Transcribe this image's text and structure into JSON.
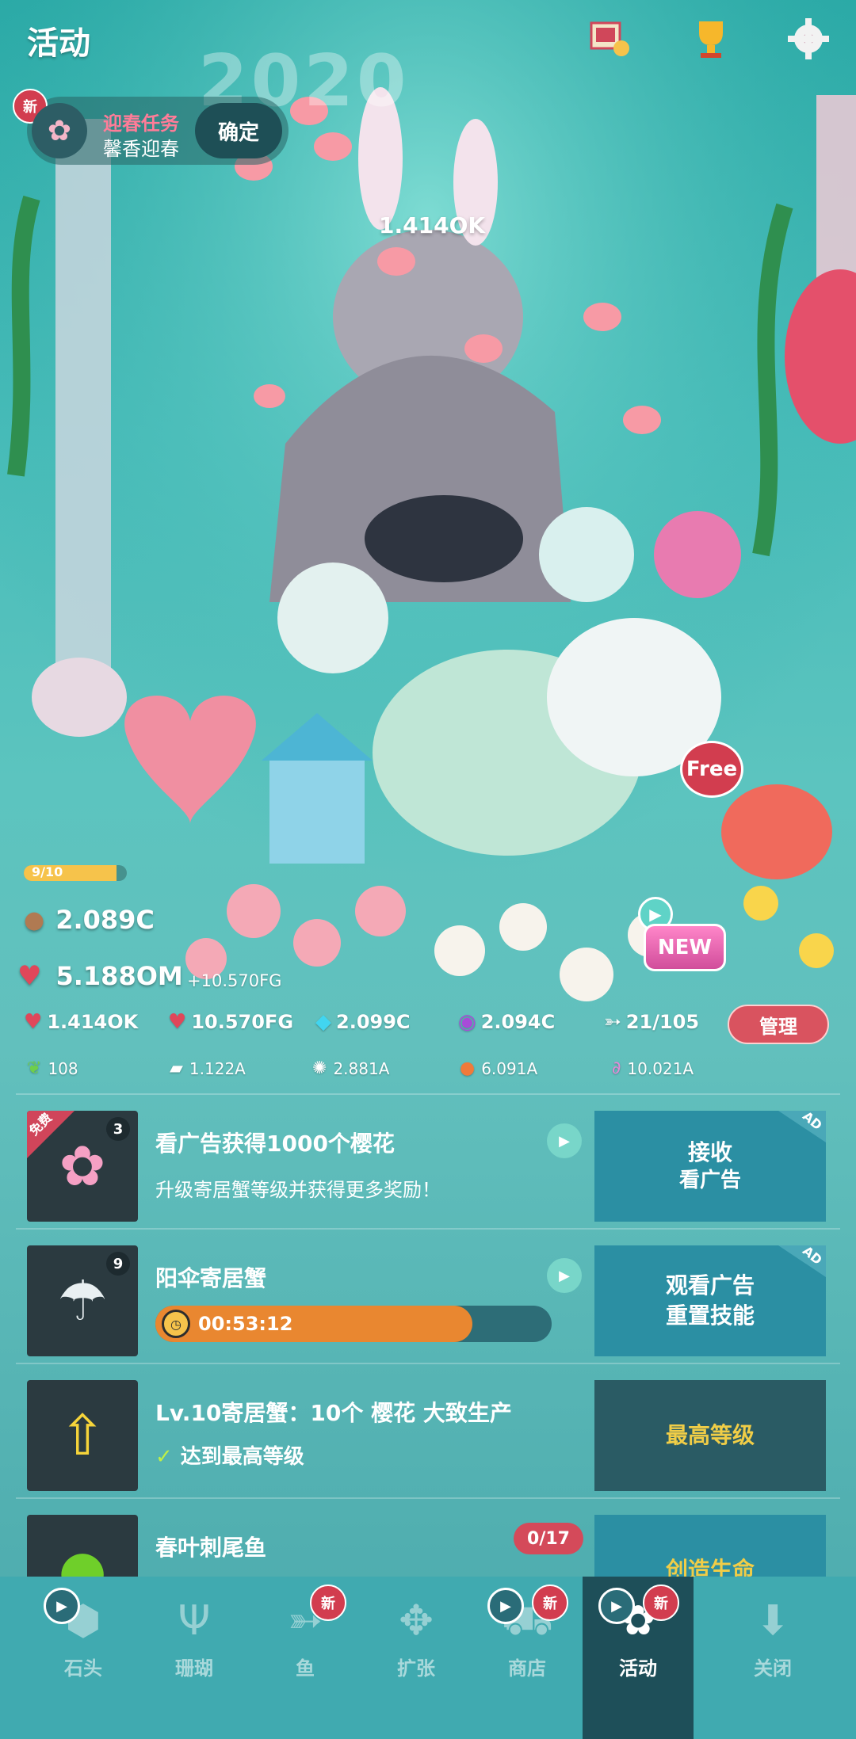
{
  "header": {
    "title": "活动",
    "year_text": "2020",
    "icons": [
      "photo-album-icon",
      "trophy-icon",
      "settings-gear-icon"
    ]
  },
  "quest": {
    "new_badge": "新",
    "title": "迎春任务",
    "subtitle": "馨香迎春",
    "confirm_label": "确定"
  },
  "scene": {
    "floating_value": "1.414OK",
    "free_label": "Free",
    "new_label": "NEW",
    "level_progress_text": "9/10",
    "level_progress": 0.9
  },
  "stats": {
    "coral_value": "2.089C",
    "hearts_value": "5.188OM",
    "hearts_rate": "+10.570FG",
    "row1": [
      {
        "icon": "tap-heart-icon",
        "value": "1.414OK"
      },
      {
        "icon": "timer-heart-icon",
        "value": "10.570FG"
      },
      {
        "icon": "diamond-icon",
        "value": "2.099C"
      },
      {
        "icon": "pearl-icon",
        "value": "2.094C"
      },
      {
        "icon": "fish-icon",
        "value": "21/105"
      }
    ],
    "manage_label": "管理",
    "row2": [
      {
        "icon": "seaweed-icon",
        "value": "108"
      },
      {
        "icon": "rock-icon",
        "value": "1.122A"
      },
      {
        "icon": "urchin-icon",
        "value": "2.881A"
      },
      {
        "icon": "clownfish-icon",
        "value": "6.091A"
      },
      {
        "icon": "seahorse-icon",
        "value": "10.021A"
      }
    ]
  },
  "list": [
    {
      "corner_label": "免费",
      "count": "3",
      "title": "看广告获得1000个樱花",
      "sub": "升级寄居蟹等级并获得更多奖励！",
      "action_line1": "接收",
      "action_line2": "看广告",
      "ad_label": "AD"
    },
    {
      "count": "9",
      "title": "阳伞寄居蟹",
      "timer": "00:53:12",
      "timer_progress": 0.8,
      "action_line1": "观看广告",
      "action_line2": "重置技能",
      "ad_label": "AD"
    },
    {
      "title": "Lv.10寄居蟹：10个 樱花 大致生产",
      "sub": "达到最高等级",
      "action_line1": "最高等级"
    },
    {
      "title": "春叶刺尾鱼",
      "counter": "0/17",
      "action_line1": "创造生命"
    }
  ],
  "tabs": [
    {
      "label": "石头",
      "icon": "stone-icon",
      "play": true,
      "new": false,
      "new_label": ""
    },
    {
      "label": "珊瑚",
      "icon": "coral-icon",
      "play": false,
      "new": false,
      "new_label": ""
    },
    {
      "label": "鱼",
      "icon": "fish-icon",
      "play": false,
      "new": true,
      "new_label": "新"
    },
    {
      "label": "扩张",
      "icon": "expand-icon",
      "play": false,
      "new": false,
      "new_label": ""
    },
    {
      "label": "商店",
      "icon": "shop-cart-icon",
      "play": true,
      "new": true,
      "new_label": "新"
    },
    {
      "label": "活动",
      "icon": "sakura-icon",
      "play": true,
      "new": true,
      "new_label": "新",
      "active": true
    },
    {
      "label": "关闭",
      "icon": "close-download-icon",
      "play": false,
      "new": false,
      "new_label": ""
    }
  ],
  "colors": {
    "accent_red": "#d23d4f",
    "action_blue": "#2b8fa3",
    "action_dark": "#2a5b64",
    "timer_orange": "#e98730",
    "max_level_yellow": "#f0cd47"
  }
}
